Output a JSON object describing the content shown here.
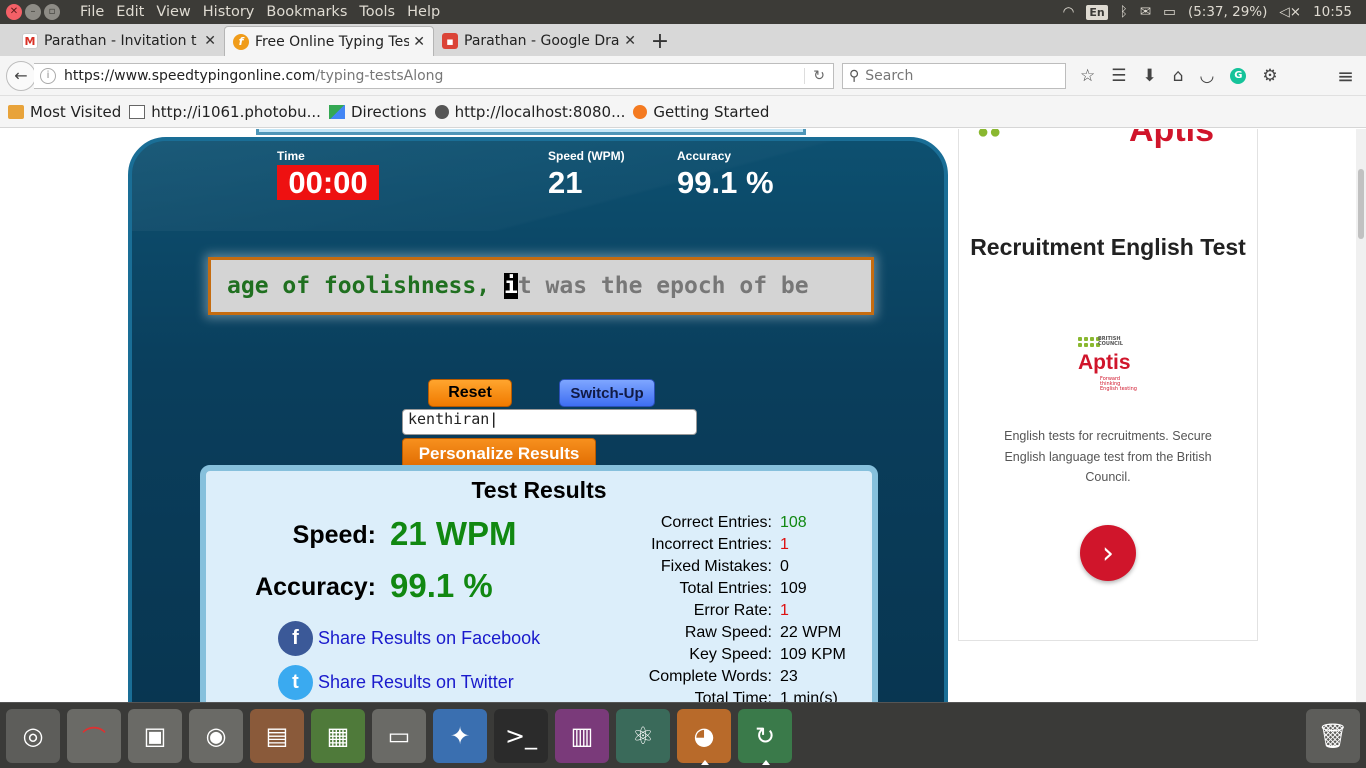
{
  "topbar": {
    "menu": [
      "File",
      "Edit",
      "View",
      "History",
      "Bookmarks",
      "Tools",
      "Help"
    ],
    "keyboard": "En",
    "battery": "(5:37, 29%)",
    "clock": "10:55"
  },
  "tabs": [
    {
      "title": "Parathan - Invitation t",
      "icon": "gmail-icon"
    },
    {
      "title": "Free Online Typing Tes",
      "icon": "speedtyping-icon"
    },
    {
      "title": "Parathan - Google Dra",
      "icon": "google-drawings-icon"
    }
  ],
  "navbar": {
    "url_domain": "https://www.speedtypingonline.com",
    "url_path": "/typing-testsAlong",
    "search_placeholder": "Search"
  },
  "bookmarks": [
    {
      "label": "Most Visited",
      "icon": "folder"
    },
    {
      "label": "http://i1061.photobu...",
      "icon": "page"
    },
    {
      "label": "Directions",
      "icon": "maps"
    },
    {
      "label": "http://localhost:8080...",
      "icon": "globe"
    },
    {
      "label": "Getting Started",
      "icon": "firefox"
    }
  ],
  "game": {
    "time_label": "Time",
    "time_value": "00:00",
    "speed_label": "Speed (WPM)",
    "speed_value": "21",
    "accuracy_label": "Accuracy",
    "accuracy_value": "99.1 %",
    "typed_text": "age of foolishness, ",
    "cursor_char": "i",
    "remaining_text": "t was the epoch of be",
    "reset_label": "Reset",
    "switchup_label": "Switch-Up",
    "name_value": "kenthiran",
    "personalize_label": "Personalize Results"
  },
  "results": {
    "title": "Test Results",
    "speed_label": "Speed:",
    "speed_value": "21 WPM",
    "accuracy_label": "Accuracy:",
    "accuracy_value": "99.1 %",
    "share_facebook": "Share Results on Facebook",
    "share_twitter": "Share Results on Twitter",
    "stats": [
      {
        "name": "Correct Entries:",
        "value": "108",
        "color": "green"
      },
      {
        "name": "Incorrect Entries:",
        "value": "1",
        "color": "red"
      },
      {
        "name": "Fixed Mistakes:",
        "value": "0",
        "color": "black"
      },
      {
        "name": "Total Entries:",
        "value": "109",
        "color": "black"
      },
      {
        "name": "Error Rate:",
        "value": "1",
        "color": "red"
      },
      {
        "name": "Raw Speed:",
        "value": "22 WPM",
        "color": "black"
      },
      {
        "name": "Key Speed:",
        "value": "109 KPM",
        "color": "black"
      },
      {
        "name": "Complete Words:",
        "value": "23",
        "color": "black"
      },
      {
        "name": "Total Time:",
        "value": "1 min(s)",
        "color": "black"
      }
    ]
  },
  "ad": {
    "title": "Recruitment English Test",
    "logo_text": "Aptis",
    "logo_tagline": "Forward thinking English testing",
    "council_text": "BRITISH COUNCIL",
    "description": "English tests for recruitments. Secure English language test from the British Council."
  },
  "dock": [
    "ubuntu-dash-icon",
    "document-viewer-icon",
    "image-viewer-icon",
    "screenshot-icon",
    "impress-icon",
    "calc-icon",
    "files-icon",
    "compass-icon",
    "terminal-icon",
    "workspace-switcher-icon",
    "atom-icon",
    "firefox-icon",
    "software-updater-icon",
    "trash-icon"
  ],
  "colors": {
    "panel_blue": "#0a3e5c",
    "timer_red": "#ee1111",
    "typed_green": "#207020",
    "result_green": "#118811",
    "error_red": "#dd1111",
    "orange_button": "#f07a00",
    "aptis_red": "#d0152b"
  }
}
